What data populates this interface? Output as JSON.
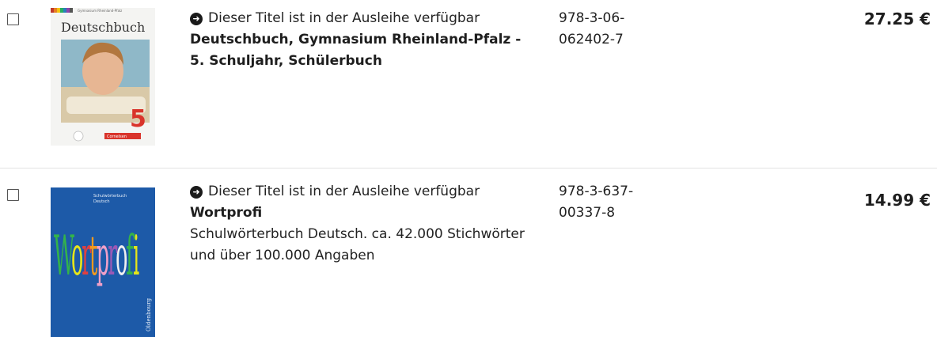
{
  "items": [
    {
      "availability": "Dieser Titel ist in der Ausleihe verfügbar",
      "title": "Deutschbuch, Gymnasium Rheinland-Pfalz - 5. Schuljahr, Schülerbuch",
      "subtitle": "",
      "isbn_part1": "978-3-06-",
      "isbn_part2": "062402-7",
      "price": "27.25 €",
      "cover": {
        "heading": "Deutschbuch",
        "top_text": "Gymnasium Rheinland-Pfalz",
        "number": "5",
        "publisher": "Cornelsen"
      }
    },
    {
      "availability": "Dieser Titel ist in der Ausleihe verfügbar",
      "title": "Wortprofi",
      "subtitle": "Schulwörterbuch Deutsch. ca. 42.000 Stichwörter und über 100.000 Angaben",
      "isbn_part1": "978-3-637-",
      "isbn_part2": "00337-8",
      "price": "14.99 €",
      "cover": {
        "top_line1": "Schulwörterbuch",
        "top_line2": "Deutsch",
        "word": "Wortprofi",
        "publisher": "Oldenbourg"
      }
    }
  ],
  "icons": {
    "availability": "circle-arrow-right-icon"
  },
  "colors": {
    "cover2_bg": "#1d5aa8",
    "cover1_number": "#d9342b"
  }
}
